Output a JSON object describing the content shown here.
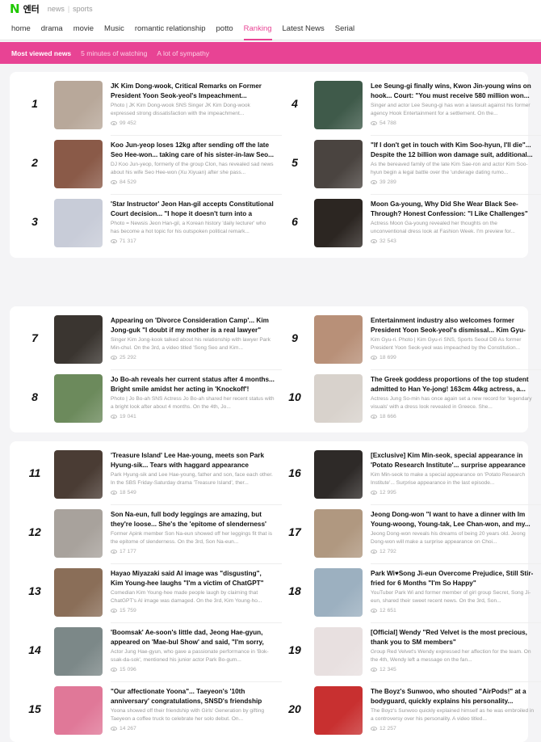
{
  "header": {
    "logo_mark": "N",
    "logo_text": "엔터",
    "links": [
      "news",
      "sports"
    ]
  },
  "nav": [
    {
      "label": "home",
      "active": false
    },
    {
      "label": "drama",
      "active": false
    },
    {
      "label": "movie",
      "active": false
    },
    {
      "label": "Music",
      "active": false
    },
    {
      "label": "romantic relationship",
      "active": false
    },
    {
      "label": "potto",
      "active": false
    },
    {
      "label": "Ranking",
      "active": true
    },
    {
      "label": "Latest News",
      "active": false
    },
    {
      "label": "Serial",
      "active": false
    }
  ],
  "subnav": [
    {
      "label": "Most viewed news",
      "active": true
    },
    {
      "label": "5 minutes of watching",
      "active": false
    },
    {
      "label": "A lot of sympathy",
      "active": false
    }
  ],
  "colors": {
    "accent": "#e84394",
    "brand_green": "#1ec800"
  },
  "rankings": [
    {
      "rank": "1",
      "title": "JK Kim Dong-wook, Critical Remarks on Former President Yoon Seok-yeol's Impeachment... \"South...",
      "desc": "Photo | JK Kim Dong-wook SNS Singer JK Kim Dong-wook expressed strong dissatisfaction with the impeachment...",
      "views": "99 452",
      "thumb": "#b8a89a"
    },
    {
      "rank": "2",
      "title": "Koo Jun-yeop loses 12kg after sending off the late Seo Hee-won... taking care of his sister-in-law Seo...",
      "desc": "DJ Koo Jun-yeop, formerly of the group Clon, has revealed sad news about his wife Seo Hee-won (Xu Xiyuan) after she pass...",
      "views": "84 529",
      "thumb": "#8a5a48"
    },
    {
      "rank": "3",
      "title": "'Star Instructor' Jeon Han-gil accepts Constitutional Court decision... \"I hope it doesn't turn into a secon...",
      "desc": "Photo = Newsis Jeon Han-gil, a Korean history 'daily lecturer' who has become a hot topic for his outspoken political remark...",
      "views": "71 317",
      "thumb": "#c8ccd8"
    },
    {
      "rank": "4",
      "title": "Lee Seung-gi finally wins, Kwon Jin-young wins on hook... Court: \"You must receive 580 million won...",
      "desc": "Singer and actor Lee Seung-gi has won a lawsuit against his former agency Hook Entertainment for a settlement. On the...",
      "views": "54 788",
      "thumb": "#3f5a4a"
    },
    {
      "rank": "5",
      "title": "\"If I don't get in touch with Kim Soo-hyun, I'll die\"... Despite the 12 billion won damage suit, additional...",
      "desc": "As the bereaved family of the late Kim Sae-ron and actor Kim Soo-hyun begin a legal battle over the 'underage dating rumo...",
      "views": "39 289",
      "thumb": "#4a4440"
    },
    {
      "rank": "6",
      "title": "Moon Ga-young, Why Did She Wear Black See-Through? Honest Confession: \"I Like Challenges\"",
      "desc": "Actress Moon Ga-young revealed her thoughts on the unconventional dress look at Fashion Week. I'm preview for...",
      "views": "32 543",
      "thumb": "#2c2622"
    },
    {
      "rank": "7",
      "title": "Appearing on 'Divorce Consideration Camp'... Kim Jong-guk \"I doubt if my mother is a real lawyer\"",
      "desc": "Singer Kim Jong-kook talked about his relationship with lawyer Park Min-chul. On the 3rd, a video titled 'Song Seo and Kim...",
      "views": "25 292",
      "thumb": "#3a3530"
    },
    {
      "rank": "8",
      "title": "Jo Bo-ah reveals her current status after 4 months... Bright smile amidst her acting in 'Knockoff'!",
      "desc": "Photo | Jo Bo-ah SNS Actress Jo Bo-ah shared her recent status with a bright look after about 4 months. On the 4th, Jo...",
      "views": "19 041",
      "thumb": "#6c8a5c"
    },
    {
      "rank": "9",
      "title": "Entertainment industry also welcomes former President Yoon Seok-yeol's dismissal... Kim Gyu-ri,...",
      "desc": "Kim Gyu-ri. Photo | Kim Gyu-ri SNS, Sports Seoul DB As former President Yoon Seok-yeol was impeached by the Constitution...",
      "views": "18 699",
      "thumb": "#b89078"
    },
    {
      "rank": "10",
      "title": "The Greek goddess proportions of the top student admitted to Han Ye-jong! 163cm 44kg actress, a...",
      "desc": "Actress Jung So-min has once again set a new record for 'legendary visuals' with a dress look revealed in Greece. She...",
      "views": "18 666",
      "thumb": "#d8d2cc"
    },
    {
      "rank": "11",
      "title": "'Treasure Island' Lee Hae-young, meets son Park Hyung-sik... Tears with haggard appearance",
      "desc": "Park Hyung-sik and Lee Hae-young, father and son, face each other. In the SBS Friday-Saturday drama 'Treasure Island', ther...",
      "views": "18 549",
      "thumb": "#4a3c34"
    },
    {
      "rank": "12",
      "title": "Son Na-eun, full body leggings are amazing, but they're loose... She's the 'epitome of slenderness'",
      "desc": "Former Apink member Son Na-eun showed off her leggings fit that is the epitome of slenderness. On the 3rd, Son Na-eun...",
      "views": "17 177",
      "thumb": "#a8a29c"
    },
    {
      "rank": "13",
      "title": "Hayao Miyazaki said AI image was \"disgusting\", Kim Young-hee laughs \"I'm a victim of ChatGPT\"",
      "desc": "Comedian Kim Young-hee made people laugh by claiming that ChatGPT's AI image was damaged. On the 3rd, Kim Young-ho...",
      "views": "15 759",
      "thumb": "#8a6e58"
    },
    {
      "rank": "14",
      "title": "'Boomsak' Ae-soon's little dad, Jeong Hae-gyun, appeared on 'Mae-bul Show' and said, \"I'm sorry, it'...",
      "desc": "Actor Jung Hae-gyun, who gave a passionate performance in 'Bok-ssak-da-sok', mentioned his junior actor Park Bo-gum...",
      "views": "15 096",
      "thumb": "#7c8888"
    },
    {
      "rank": "15",
      "title": "\"Our affectionate Yoona\"... Taeyeon's '10th anniversary' congratulations, SNSD's friendship is...",
      "desc": "Yoona showed off their friendship with Girls' Generation by gifting Taeyeon a coffee truck to celebrate her solo debut. On...",
      "views": "14 267",
      "thumb": "#e07898"
    },
    {
      "rank": "16",
      "title": "[Exclusive] Kim Min-seok, special appearance in 'Potato Research Institute'... surprise appearance in...",
      "desc": "Kim Min-seok to make a special appearance on 'Potato Research Institute'... Surprise appearance in the last episode...",
      "views": "12 995",
      "thumb": "#2e2a28"
    },
    {
      "rank": "17",
      "title": "Jeong Dong-won \"I want to have a dinner with Im Young-woong, Young-tak, Lee Chan-won, and my...",
      "desc": "Jeong Dong-won reveals his dreams of being 20 years old. Jeong Dong-won will make a surprise appearance on Choi...",
      "views": "12 792",
      "thumb": "#b09880"
    },
    {
      "rank": "18",
      "title": "Park Wi♥Song Ji-eun Overcome Prejudice, Still Stir-fried for 6 Months \"I'm So Happy\"",
      "desc": "YouTuber Park Wi and former member of girl group Secret, Song Ji-eun, shared their sweet recent news. On the 3rd, Son...",
      "views": "12 651",
      "thumb": "#9cb0c0"
    },
    {
      "rank": "19",
      "title": "[Official] Wendy \"Red Velvet is the most precious, thank you to SM members\"",
      "desc": "Group Red Velvet's Wendy expressed her affection for the team. On the 4th, Wendy left a message on the fan...",
      "views": "12 345",
      "thumb": "#e8e0e0"
    },
    {
      "rank": "20",
      "title": "The Boyz's Sunwoo, who shouted \"AirPods!\" at a bodyguard, quickly explains his personality...",
      "desc": "The Boyz's Sunwoo quickly explained himself as he was embroiled in a controversy over his personality. A video titled...",
      "views": "12 257",
      "thumb": "#c83030"
    }
  ]
}
